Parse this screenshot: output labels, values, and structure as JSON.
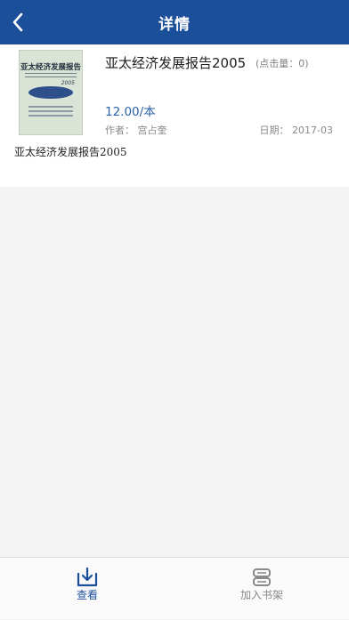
{
  "header": {
    "title": "详情",
    "back_icon": "chevron-left-icon"
  },
  "book": {
    "cover": {
      "title": "亚太经济发展报告",
      "year": "2005"
    },
    "title": "亚太经济发展报告2005",
    "clicks": "(点击量：0)",
    "price": "12.00/本",
    "author": "作者：  宫占奎",
    "date": "日期：  2017-03",
    "description": "亚太经济发展报告2005"
  },
  "tabbar": {
    "items": [
      {
        "label": "查看",
        "icon": "download-tray-icon",
        "active": true
      },
      {
        "label": "加入书架",
        "icon": "bookshelf-icon",
        "active": false
      }
    ]
  },
  "colors": {
    "header_bg": "#1b4f9a",
    "accent": "#2a62a8",
    "inactive": "#888888"
  }
}
